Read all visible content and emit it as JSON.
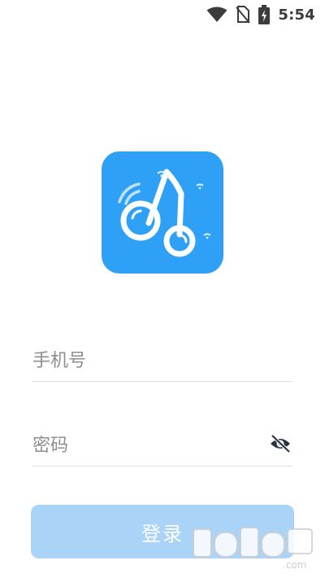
{
  "status_bar": {
    "time": "5:54",
    "icons": [
      "wifi-icon",
      "no-sim-icon",
      "battery-charging-icon"
    ]
  },
  "app": {
    "logo_icon": "music-note-app-icon",
    "brand_color": "#2ea0f5"
  },
  "login_form": {
    "phone": {
      "placeholder": "手机号",
      "value": ""
    },
    "password": {
      "placeholder": "密码",
      "value": "",
      "toggle_icon": "eye-off-icon"
    },
    "submit_label": "登录",
    "submit_color": "#a9d4f7"
  },
  "watermark": {
    "text": "k73.com"
  }
}
